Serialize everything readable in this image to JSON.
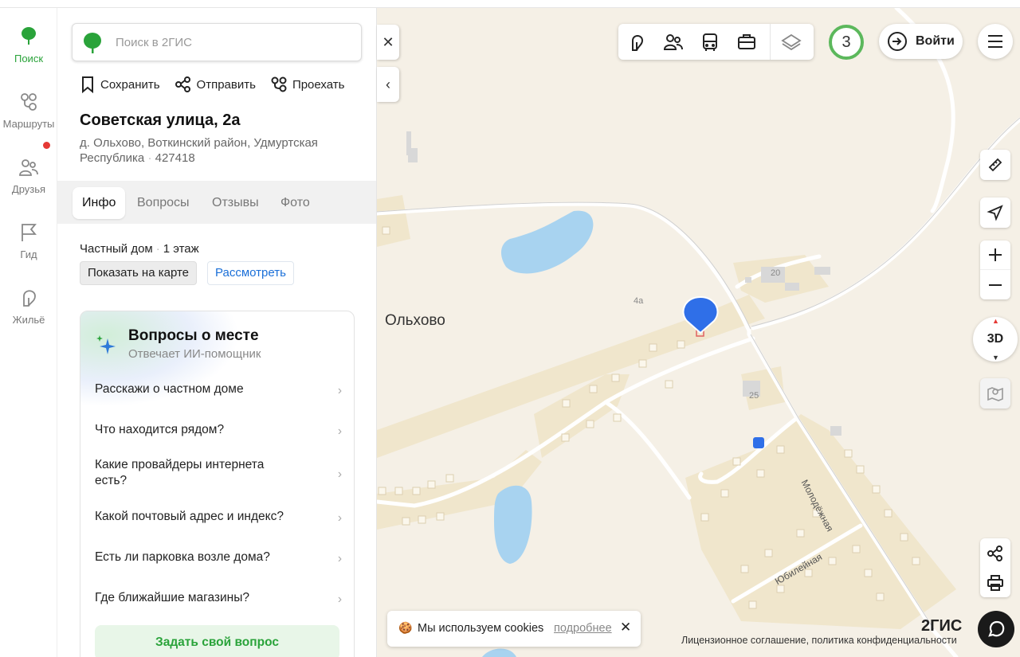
{
  "rail": {
    "items": [
      {
        "label": "Поиск",
        "icon": "search-tree-icon",
        "active": true
      },
      {
        "label": "Маршруты",
        "icon": "routes-icon"
      },
      {
        "label": "Друзья",
        "icon": "friends-icon"
      },
      {
        "label": "Гид",
        "icon": "guide-flag-icon"
      },
      {
        "label": "Жильё",
        "icon": "housing-icon"
      }
    ]
  },
  "search": {
    "placeholder": "Поиск в 2ГИС"
  },
  "actions": {
    "save": "Сохранить",
    "share": "Отправить",
    "route": "Проехать"
  },
  "place": {
    "title": "Советская улица, 2а",
    "address": "д. Ольхово, Воткинский район, Удмуртская Республика",
    "postcode": "427418"
  },
  "tabs": [
    {
      "label": "Инфо",
      "active": true
    },
    {
      "label": "Вопросы"
    },
    {
      "label": "Отзывы"
    },
    {
      "label": "Фото"
    }
  ],
  "info": {
    "type": "Частный дом",
    "floors": "1 этаж",
    "show_on_map": "Показать на карте",
    "view": "Рассмотреть"
  },
  "questions": {
    "title": "Вопросы о месте",
    "subtitle": "Отвечает ИИ-помощник",
    "items": [
      "Расскажи о частном доме",
      "Что находится рядом?",
      "Какие провайдеры интернета есть?",
      "Какой почтовый адрес и индекс?",
      "Есть ли парковка возле дома?",
      "Где ближайшие магазины?"
    ],
    "ask_button": "Задать свой вопрос"
  },
  "map": {
    "village_label": "Ольхово",
    "house_numbers": [
      "4а",
      "20",
      "25"
    ],
    "streets": [
      "Молодёжная",
      "Юбилейная"
    ],
    "brand_green": "#2aa33a",
    "pin_color": "#2f6fe8",
    "water_color": "#a8d3f0"
  },
  "toolbar": {
    "icons": [
      "cafe-icon",
      "people-icon",
      "bus-icon",
      "briefcase-icon",
      "layers-icon"
    ],
    "badge": "3",
    "login": "Войти"
  },
  "cookie": {
    "text": "Мы используем cookies",
    "more": "подробнее",
    "close": "✕"
  },
  "footer": {
    "brand": "2ГИС",
    "license": "Лицензионное соглашение, политика конфиденциальности"
  },
  "controls": {
    "three_d": "3D"
  }
}
